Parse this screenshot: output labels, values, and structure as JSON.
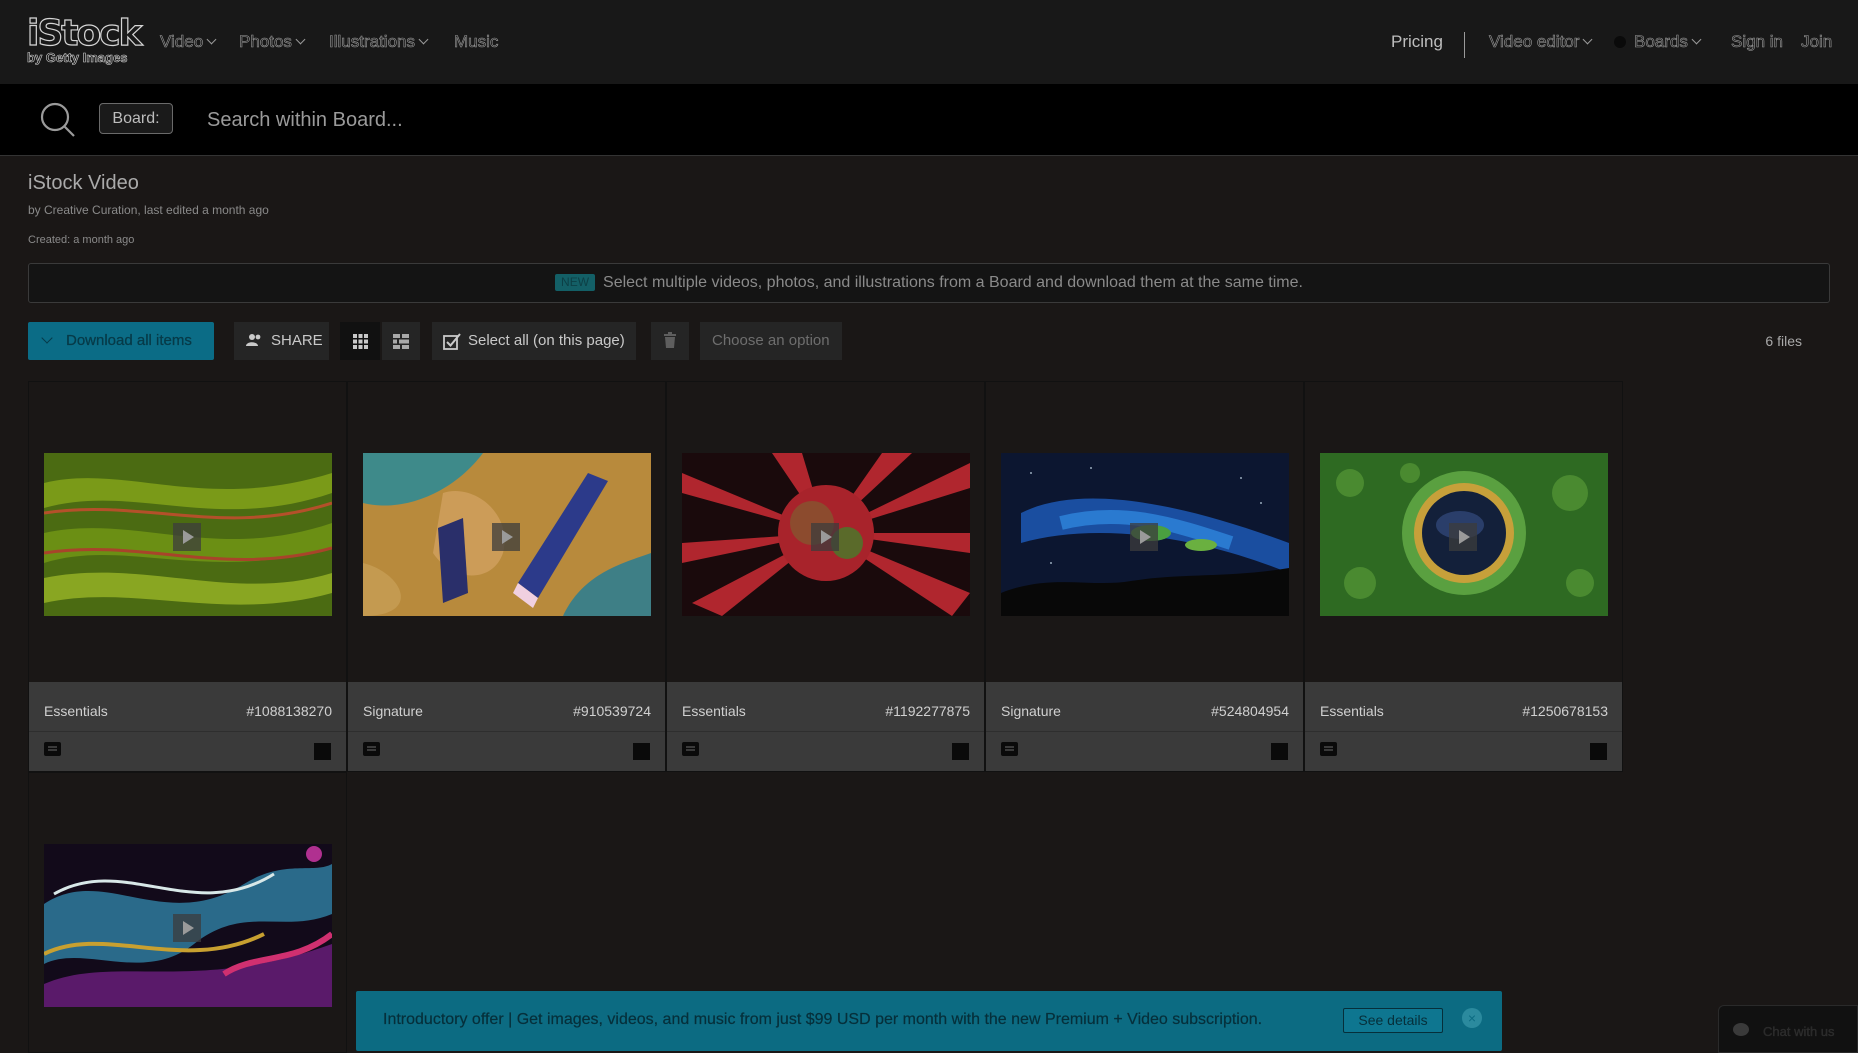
{
  "header": {
    "logo_word": "iStock",
    "logo_sub": "by Getty Images",
    "nav": [
      {
        "label": "Video"
      },
      {
        "label": "Photos"
      },
      {
        "label": "Illustrations"
      },
      {
        "label": "Music"
      }
    ],
    "pricing": "Pricing",
    "video_editor": "Video editor",
    "boards": "Boards",
    "sign_in": "Sign in",
    "join": "Join"
  },
  "search": {
    "chip": "Board:",
    "placeholder": "Search within Board..."
  },
  "board": {
    "title": "iStock Video",
    "meta": "by Creative Curation, last edited a month ago",
    "created": "Created: a month ago",
    "notice_badge": "NEW",
    "notice_text": "Select multiple videos, photos, and illustrations from a Board and download them at the same time."
  },
  "toolbar": {
    "download_label": "Download all items",
    "share_label": "SHARE",
    "select_all_label": "Select all (on this page)",
    "choose_option": "Choose an option",
    "file_count": "6 files"
  },
  "items": [
    {
      "collection": "Essentials",
      "id": "#1088138270"
    },
    {
      "collection": "Signature",
      "id": "#910539724"
    },
    {
      "collection": "Essentials",
      "id": "#1192277875"
    },
    {
      "collection": "Signature",
      "id": "#524804954"
    },
    {
      "collection": "Essentials",
      "id": "#1250678153"
    },
    {
      "collection": "",
      "id": ""
    }
  ],
  "promo": {
    "text": "Introductory offer | Get images, videos, and music from just $99 USD per month with the new Premium + Video subscription.",
    "button": "See details",
    "close": "×"
  },
  "chat": {
    "label": "Chat with us"
  }
}
